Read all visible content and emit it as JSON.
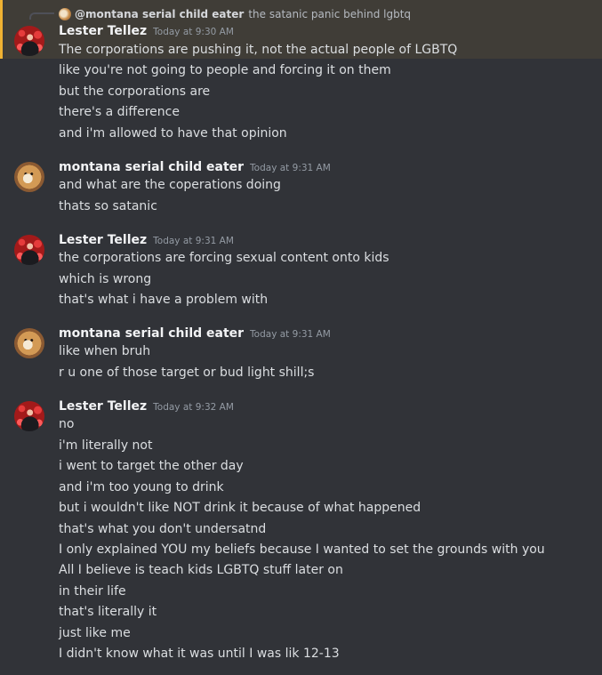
{
  "reply": {
    "author": "@montana serial child eater",
    "text": "the satanic panic behind lgbtq"
  },
  "groups": [
    {
      "author": "Lester Tellez",
      "time": "Today at 9:30 AM",
      "messages": [
        "The corporations are pushing it, not the actual people of LGBTQ",
        "like you're not going to people and forcing it on them",
        "but the corporations are",
        "there's a difference",
        "and i'm allowed to have that opinion"
      ]
    },
    {
      "author": "montana serial child eater",
      "time": "Today at 9:31 AM",
      "messages": [
        "and what are the coperations doing",
        "thats so satanic"
      ]
    },
    {
      "author": "Lester Tellez",
      "time": "Today at 9:31 AM",
      "messages": [
        "the corporations are forcing sexual content onto kids",
        "which is wrong",
        "that's what i have a problem with"
      ]
    },
    {
      "author": "montana serial child eater",
      "time": "Today at 9:31 AM",
      "messages": [
        "like when bruh",
        "r u one of those target or bud light shill;s"
      ]
    },
    {
      "author": "Lester Tellez",
      "time": "Today at 9:32 AM",
      "messages": [
        "no",
        "i'm literally not",
        "i went to target the other day",
        "and i'm too young to drink",
        "but i wouldn't like NOT drink it because of what happened",
        "that's what you don't undersatnd",
        "I only explained YOU my beliefs because I wanted to set the grounds with you",
        "All I believe is teach kids LGBTQ stuff later on",
        "in their life",
        "that's literally it",
        "just like me",
        "I didn't know what it was until I was lik 12-13"
      ]
    }
  ],
  "colors": {
    "background": "#313338",
    "mention_highlight": "#f0b232",
    "author": "#f2f3f5",
    "timestamp": "#949ba4",
    "text": "#dbdee1"
  }
}
